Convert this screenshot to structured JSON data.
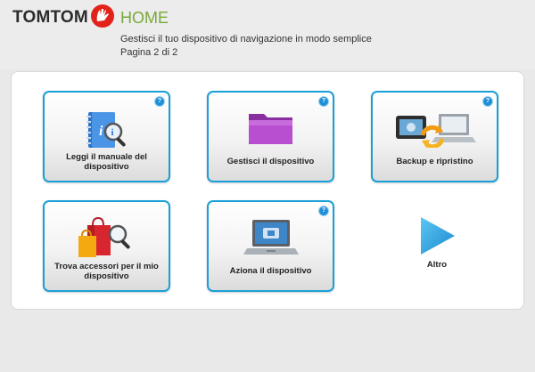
{
  "header": {
    "logo_text": "TOMTOM",
    "title": "HOME",
    "subtitle": "Gestisci il tuo dispositivo di navigazione in modo semplice",
    "page_indicator": "Pagina 2 di 2"
  },
  "tiles": [
    {
      "label": "Leggi il manuale del dispositivo",
      "icon": "manual-book-icon",
      "has_help": true
    },
    {
      "label": "Gestisci il dispositivo",
      "icon": "purple-folder-icon",
      "has_help": true
    },
    {
      "label": "Backup e ripristino",
      "icon": "backup-restore-icon",
      "has_help": true
    },
    {
      "label": "Trova accessori per il mio dispositivo",
      "icon": "shopping-bags-icon",
      "has_help": false
    },
    {
      "label": "Aziona il dispositivo",
      "icon": "laptop-icon",
      "has_help": true
    }
  ],
  "help_symbol": "?",
  "next": {
    "label": "Altro",
    "icon": "play-arrow-icon"
  },
  "colors": {
    "accent_blue": "#1aa0d8",
    "home_green": "#7aa83a",
    "logo_red": "#e2231a"
  }
}
